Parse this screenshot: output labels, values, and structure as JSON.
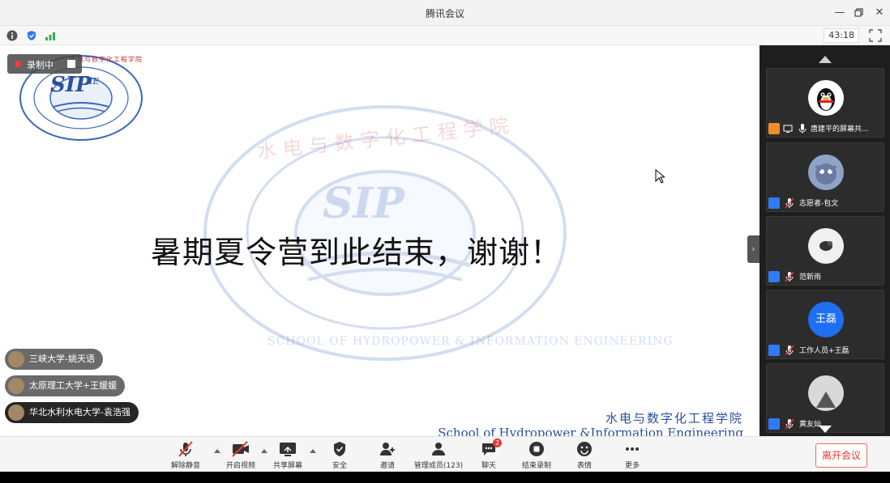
{
  "window": {
    "title": "腾讯会议"
  },
  "infobar": {
    "timer": "43:18"
  },
  "recording": {
    "label": "录制中"
  },
  "slide": {
    "headline": "暑期夏令营到此结束，谢谢！",
    "school_cn": "水电与数字化工程学院",
    "school_en": "School of Hydropower &Information Engineering",
    "logo_text_cn": "水电与数字化工程学院",
    "logo_text_en": "SCHOOL OF HYDROPOWER & INFORMATION ENGINEERING",
    "logo_mark": "SIP",
    "logo_mark_sub": "IE"
  },
  "notifications": [
    {
      "text": "三峡大学-姚天语"
    },
    {
      "text": "太原理工大学+王媛媛"
    },
    {
      "text": "华北水利水电大学-袁浩强"
    }
  ],
  "participants": [
    {
      "name": "唐建平的屏幕共...",
      "avatar_text": ""
    },
    {
      "name": "志愿者-包文",
      "avatar_text": ""
    },
    {
      "name": "范新雨",
      "avatar_text": ""
    },
    {
      "name": "工作人员+王磊",
      "avatar_text": "王磊"
    },
    {
      "name": "黄友灿",
      "avatar_text": ""
    }
  ],
  "toolbar": {
    "unmute": "解除静音",
    "video": "开启视频",
    "share": "共享屏幕",
    "security": "安全",
    "invite": "邀请",
    "members": "管理成员(123)",
    "chat": "聊天",
    "chat_badge": "2",
    "stop_record": "结束录制",
    "reactions": "表情",
    "more": "更多",
    "leave": "离开会议"
  },
  "colors": {
    "accent_blue": "#2a4f9c",
    "leave_red": "#e53935",
    "host_orange": "#f08c2e",
    "role_blue": "#2f7bf6",
    "avatar_blue": "#1e6ff2"
  }
}
